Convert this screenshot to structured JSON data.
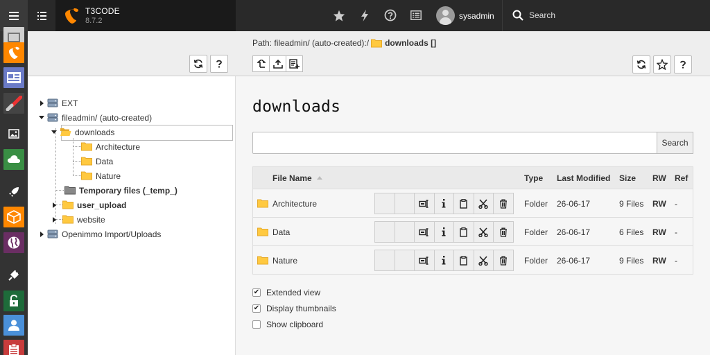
{
  "app": {
    "name": "T3CODE",
    "version": "8.7.2"
  },
  "topbar": {
    "user_name": "sysadmin",
    "search_placeholder": "Search",
    "icons": [
      "menu-icon",
      "list-icon",
      "star-icon",
      "bolt-icon",
      "help-icon",
      "system-info-icon"
    ]
  },
  "modules": [
    "page-module",
    "typo3-module",
    "news-module",
    "brush-module",
    "image-module",
    "cloud-module",
    "rocket-module",
    "package-module",
    "globe-module",
    "plug-module",
    "lock-module",
    "user-module",
    "clipboard-module"
  ],
  "tree": {
    "items": [
      {
        "label": "EXT",
        "bold": false
      },
      {
        "label": "fileadmin/ (auto-created)",
        "bold": false
      },
      {
        "label": "downloads",
        "bold": false
      },
      {
        "label": "Architecture",
        "bold": false
      },
      {
        "label": "Data",
        "bold": false
      },
      {
        "label": "Nature",
        "bold": false
      },
      {
        "label": "Temporary files (_temp_)",
        "bold": true
      },
      {
        "label": "user_upload",
        "bold": true
      },
      {
        "label": "website",
        "bold": false
      },
      {
        "label": "Openimmo Import/Uploads",
        "bold": false
      }
    ]
  },
  "docheader": {
    "path_label": "Path: fileadmin/ (auto-created):/",
    "path_current": "downloads []"
  },
  "main": {
    "title": "downloads",
    "search_button": "Search",
    "search_value": "",
    "columns": [
      "File Name",
      "Type",
      "Last Modified",
      "Size",
      "RW",
      "Ref"
    ],
    "rows": [
      {
        "name": "Architecture",
        "type": "Folder",
        "modified": "26-06-17",
        "size": "9 Files",
        "rw": "RW",
        "ref": "-"
      },
      {
        "name": "Data",
        "type": "Folder",
        "modified": "26-06-17",
        "size": "6 Files",
        "rw": "RW",
        "ref": "-"
      },
      {
        "name": "Nature",
        "type": "Folder",
        "modified": "26-06-17",
        "size": "9 Files",
        "rw": "RW",
        "ref": "-"
      }
    ],
    "options": [
      {
        "label": "Extended view",
        "checked": true
      },
      {
        "label": "Display thumbnails",
        "checked": true
      },
      {
        "label": "Show clipboard",
        "checked": false
      }
    ]
  },
  "colors": {
    "topbar": "#292929",
    "accent": "#ff8700",
    "rw": "#c83c3c",
    "folder": "#ffc940"
  }
}
